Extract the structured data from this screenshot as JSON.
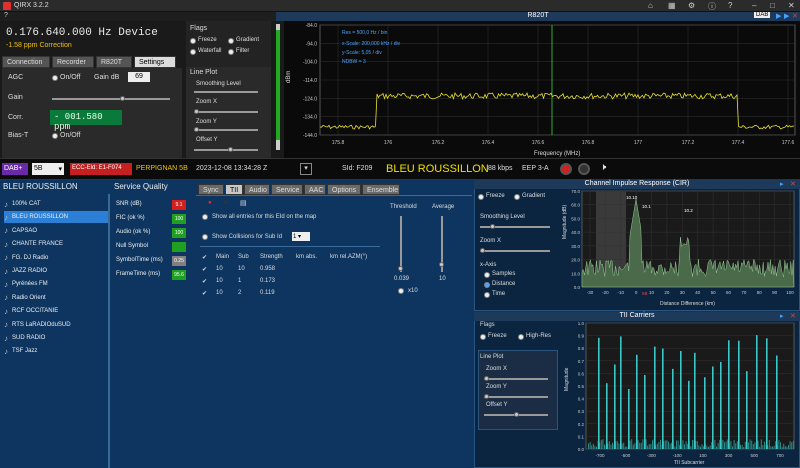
{
  "window": {
    "title": "QIRX 3.2.2"
  },
  "device": {
    "frequency": "0.176.640.000 Hz  Device",
    "ppm": "-1.58 ppm Correction"
  },
  "tabs": [
    "Connection",
    "Recorder",
    "R820T",
    "Settings"
  ],
  "settings": {
    "agc": "AGC",
    "onoff": "On/Off",
    "gain_db": "Gain dB",
    "gain_val": "69",
    "gain": "Gain",
    "corr": "Corr.",
    "corr_val": "- 001.580 ppm",
    "bias": "Bias-T",
    "bias_onoff": "On/Off"
  },
  "flags": {
    "title": "Flags",
    "freeze": "Freeze",
    "gradient": "Gradient",
    "waterfall": "Waterfall",
    "filter": "Filter",
    "lineplot": "Line Plot",
    "smoothing": "Smoothing Level",
    "zoomx": "Zoom X",
    "zoomy": "Zoom Y",
    "offsety": "Offset Y"
  },
  "spectrum": {
    "title": "R820T",
    "dab": "DAB",
    "info1": "Res = 500,0 Hz / bin",
    "info2": "x-Scale: 200,000 kHz / div",
    "info3": "y-Scale: 5,05 / div",
    "info4": "NDBW = 3",
    "ylabel": "dBm",
    "xlabel": "Frequency (MHz)",
    "yticks": [
      "-84.0",
      "-94.0",
      "-104.0",
      "-114.0",
      "-124.0",
      "-134.0",
      "-144.0"
    ],
    "xticks": [
      "175.8",
      "176",
      "176.2",
      "176.4",
      "176.6",
      "176.8",
      "177",
      "177.2",
      "177.4",
      "177.6"
    ]
  },
  "status": {
    "mode": "DAB+",
    "block": "5B",
    "ecc": "ECC-Eld: E1-F074",
    "ensemble": "PERPIGNAN 5B",
    "datetime": "2023-12-08  13:34:28 Z",
    "sid": "SId: F209",
    "station": "BLEU ROUSSILLON",
    "kbps": "88 kbps",
    "eep": "EEP 3-A"
  },
  "stationlist": {
    "title": "BLEU ROUSSILLON",
    "items": [
      "100% CAT",
      "BLEU ROUSSILLON",
      "CAPSAO",
      "CHANTE FRANCE",
      "FG. DJ Radio",
      "JAZZ RADIO",
      "Pyrénées FM",
      "Radio Orient",
      "RCF OCCITANIE",
      "RTS LaRADIOduSUD",
      "SUD RADIO",
      "TSF Jazz"
    ]
  },
  "quality": {
    "title": "Service Quality",
    "rows": [
      {
        "label": "SNR (dB)",
        "value": "9.1",
        "color": "#d02020"
      },
      {
        "label": "FIC (ok %)",
        "value": "100",
        "color": "#20a020"
      },
      {
        "label": "Audio (ok %)",
        "value": "100",
        "color": "#20a020"
      },
      {
        "label": "Null Symbol",
        "value": "",
        "color": "#20a020"
      },
      {
        "label": "SymbolTime (ms)",
        "value": "0.25",
        "color": "#808080"
      },
      {
        "label": "FrameTime (ms)",
        "value": "95.6",
        "color": "#20a020"
      }
    ]
  },
  "tii": {
    "tabs": [
      "Sync",
      "TII",
      "Audio",
      "Service",
      "AAC",
      "Options",
      "Ensemble"
    ],
    "show_all": "Show all entries for this EId on the map",
    "show_coll": "Show Collisions for Sub Id",
    "coll_val": "1",
    "threshold": "Threshold",
    "average": "Average",
    "thr_val": "0.039",
    "avg_val": "10",
    "x10": "x10",
    "headers": [
      "Main",
      "Sub",
      "Strength",
      "km abs.",
      "km rel.",
      "AZM(°)"
    ],
    "rows": [
      [
        "10",
        "10",
        "0.958"
      ],
      [
        "10",
        "1",
        "0.173"
      ],
      [
        "10",
        "2",
        "0.119"
      ]
    ]
  },
  "cir": {
    "title": "Channel Impulse Response (CIR)",
    "freeze": "Freeze",
    "gradient": "Gradient",
    "smoothing": "Smoothing Level",
    "zoomx": "Zoom X",
    "xaxis": "x-Axis",
    "samples": "Samples",
    "distance": "Distance",
    "time": "Time",
    "ylabel": "Magnitude (dB)",
    "xlabel": "Distance Difference (km)",
    "yticks": [
      "70.0",
      "60.0",
      "50.0",
      "40.0",
      "30.0",
      "20.0",
      "10.0",
      "0.0"
    ],
    "xticks": [
      "-30",
      "-20",
      "-10",
      "0",
      "10",
      "20",
      "30",
      "40",
      "50",
      "60",
      "70",
      "80",
      "90",
      "100"
    ],
    "label1": "10.10",
    "label2": "10.1",
    "label3": "10.2",
    "marker": "5B"
  },
  "tiic": {
    "title": "TII Carriers",
    "flags": "Flags",
    "freeze": "Freeze",
    "highres": "High-Res",
    "lineplot": "Line Plot",
    "zoomx": "Zoom X",
    "zoomy": "Zoom Y",
    "offsety": "Offset Y",
    "ylabel": "Magnitude",
    "xlabel": "TII Subcarrier",
    "yticks": [
      "1.0",
      "0.9",
      "0.8",
      "0.7",
      "0.6",
      "0.5",
      "0.4",
      "0.3",
      "0.2",
      "0.1",
      "0.0"
    ],
    "xticks": [
      "-700",
      "-500",
      "-300",
      "-100",
      "100",
      "300",
      "500",
      "700"
    ]
  }
}
